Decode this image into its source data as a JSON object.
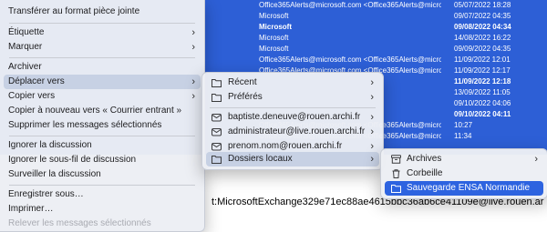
{
  "mail_list": {
    "rows": [
      {
        "sender": "Office365Alerts@microsoft.com <Office365Alerts@microsoft.…",
        "date": "05/07/2022 18:28",
        "bold": false
      },
      {
        "sender": "Microsoft",
        "date": "09/07/2022 04:35",
        "bold": false
      },
      {
        "sender": "Microsoft",
        "date": "09/08/2022 04:34",
        "bold": true
      },
      {
        "sender": "Microsoft",
        "date": "14/08/2022 16:22",
        "bold": false
      },
      {
        "sender": "Microsoft",
        "date": "09/09/2022 04:35",
        "bold": false
      },
      {
        "sender": "Office365Alerts@microsoft.com <Office365Alerts@microsoft.…",
        "date": "11/09/2022 12:01",
        "bold": false
      },
      {
        "sender": "Office365Alerts@microsoft.com <Office365Alerts@microsoft.…",
        "date": "11/09/2022 12:17",
        "bold": false
      },
      {
        "sender": "",
        "date": "11/09/2022 12:18",
        "bold": true
      },
      {
        "sender": "",
        "date": "13/09/2022 11:05",
        "bold": false
      },
      {
        "sender": "",
        "date": "09/10/2022 04:06",
        "bold": false
      },
      {
        "sender": "",
        "date": "09/10/2022 04:11",
        "bold": true
      },
      {
        "sender": "Office365Alerts@microsoft.com <Office365Alerts@microsoft.…",
        "date": "10:27",
        "bold": false
      },
      {
        "sender": "Office365Alerts@microsoft.com <Office365Alerts@microsoft.…",
        "date": "11:34",
        "bold": false
      }
    ],
    "header_text": "t:MicrosoftExchange329e71ec88ae4615bbc36ab6ce41109e@live.rouen.ar"
  },
  "main_menu": {
    "items": [
      {
        "label": "Transférer au format pièce jointe",
        "submenu": false,
        "disabled": false
      },
      {
        "label": "Étiquette",
        "submenu": true,
        "disabled": false
      },
      {
        "label": "Marquer",
        "submenu": true,
        "disabled": false
      },
      {
        "label": "Archiver",
        "submenu": false,
        "disabled": false
      },
      {
        "label": "Déplacer vers",
        "submenu": true,
        "disabled": false,
        "highlighted": true
      },
      {
        "label": "Copier vers",
        "submenu": true,
        "disabled": false
      },
      {
        "label": "Copier à nouveau vers « Courrier entrant »",
        "submenu": false,
        "disabled": false
      },
      {
        "label": "Supprimer les messages sélectionnés",
        "submenu": false,
        "disabled": false
      },
      {
        "label": "Ignorer la discussion",
        "submenu": false,
        "disabled": false
      },
      {
        "label": "Ignorer le sous-fil de discussion",
        "submenu": false,
        "disabled": false
      },
      {
        "label": "Surveiller la discussion",
        "submenu": false,
        "disabled": false
      },
      {
        "label": "Enregistrer sous…",
        "submenu": false,
        "disabled": false
      },
      {
        "label": "Imprimer…",
        "submenu": false,
        "disabled": false
      },
      {
        "label": "Relever les messages sélectionnés",
        "submenu": false,
        "disabled": true
      }
    ]
  },
  "move_submenu": {
    "items": [
      {
        "label": "Récent",
        "icon": "folder-icon",
        "submenu": true
      },
      {
        "label": "Préférés",
        "icon": "folder-icon",
        "submenu": true
      },
      {
        "label": "baptiste.deneuve@rouen.archi.fr",
        "icon": "mail-account-icon",
        "submenu": true
      },
      {
        "label": "administrateur@live.rouen.archi.fr",
        "icon": "mail-account-icon",
        "submenu": true
      },
      {
        "label": "prenom.nom@rouen.archi.fr",
        "icon": "mail-account-icon",
        "submenu": true
      },
      {
        "label": "Dossiers locaux",
        "icon": "folder-icon",
        "submenu": true,
        "highlighted": true
      }
    ]
  },
  "local_folders_submenu": {
    "items": [
      {
        "label": "Archives",
        "icon": "archive-icon",
        "submenu": true
      },
      {
        "label": "Corbeille",
        "icon": "trash-icon",
        "submenu": false
      },
      {
        "label": "Sauvegarde ENSA Normandie",
        "icon": "folder-icon",
        "submenu": false,
        "selected": true
      }
    ]
  },
  "colors": {
    "selection_blue": "#2d63e0",
    "list_blue": "#2d5fd6",
    "hover_grey": "#c7d1e4"
  }
}
